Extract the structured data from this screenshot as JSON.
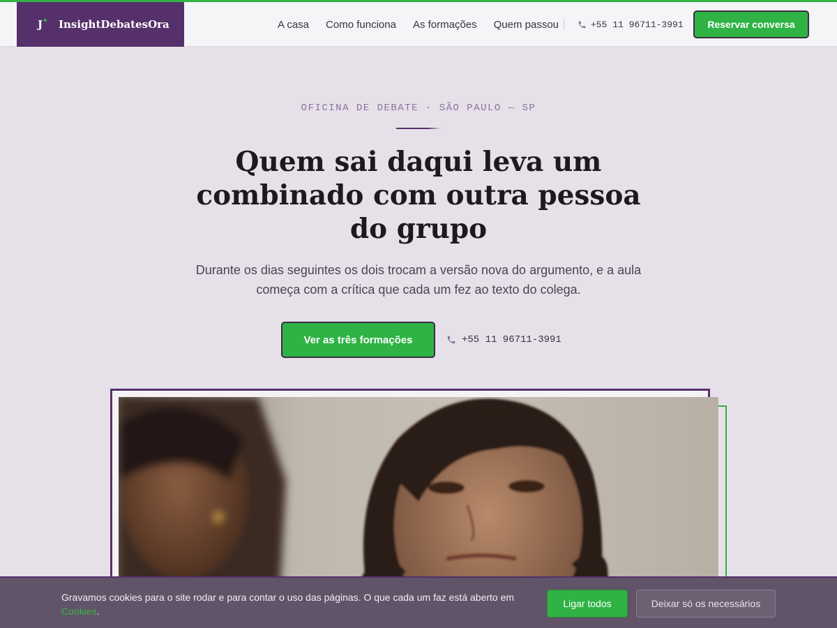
{
  "header": {
    "brand": "InsightDebatesOra",
    "brand_mark": "J",
    "nav": [
      "A casa",
      "Como funciona",
      "As formações",
      "Quem passou"
    ],
    "phone": "+55 11 96711-3991",
    "cta": "Reservar conversa"
  },
  "hero": {
    "eyebrow": "OFICINA DE DEBATE · SÃO PAULO — SP",
    "title": "Quem sai daqui leva um combinado com outra pessoa do grupo",
    "lead": "Durante os dias seguintes os dois trocam a versão nova do argumento, e a aula começa com a crítica que cada um fez ao texto do colega.",
    "cta": "Ver as três formações",
    "phone": "+55 11 96711-3991"
  },
  "cookies": {
    "text": "Gravamos cookies para o site rodar e para contar o uso das páginas. O que cada um faz está aberto em",
    "link": "Cookies",
    "period": ".",
    "accept": "Ligar todos",
    "necessary": "Deixar só os necessários"
  },
  "icons": {
    "phone": "phone-icon",
    "brand": "brand-mark-icon"
  },
  "colors": {
    "brand_purple": "#55306b",
    "accent_green": "#2fb344",
    "background": "#e6e1e9",
    "cookie_bar": "#615468"
  }
}
